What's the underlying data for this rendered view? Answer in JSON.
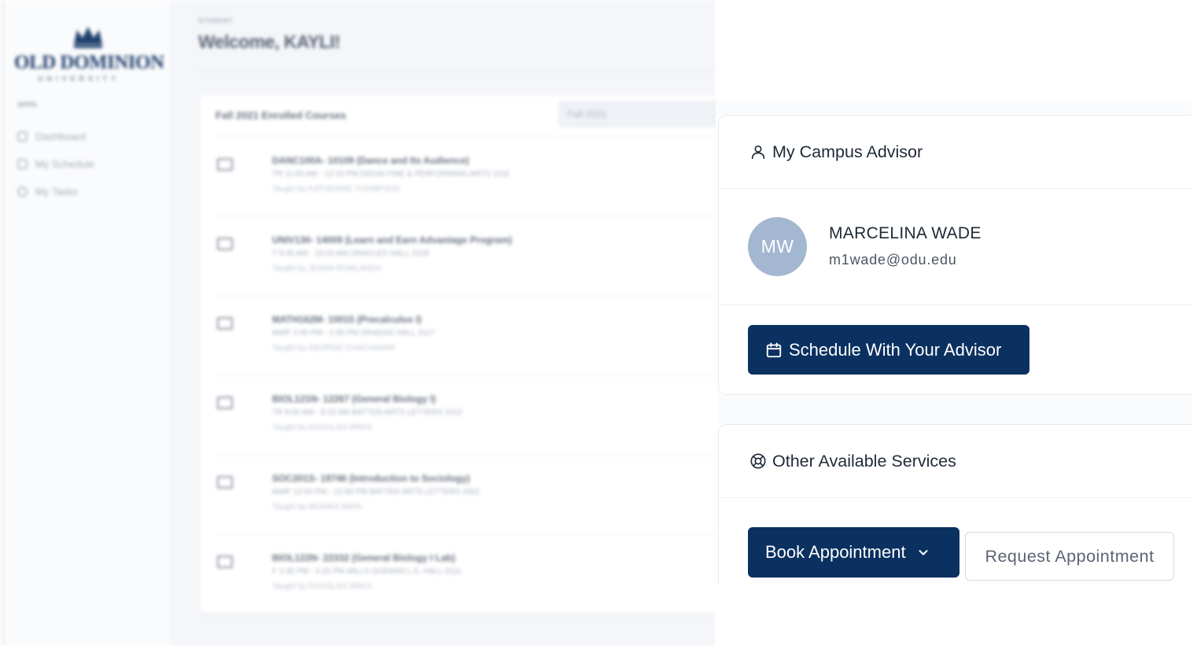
{
  "backdrop": {
    "logo": {
      "name": "OLD DOMINION",
      "sub": "UNIVERSITY"
    },
    "sidebar_caption": "APPS",
    "sidebar_items": [
      {
        "label": "Dashboard",
        "icon": "grid-icon"
      },
      {
        "label": "My Schedule",
        "icon": "calendar-icon"
      },
      {
        "label": "My Tasks",
        "icon": "clock-icon"
      }
    ],
    "breadcrumb": "STUDENT",
    "welcome": "Welcome, KAYLI!",
    "courses_title": "Fall 2021 Enrolled Courses",
    "term_select": "Fall 2021",
    "courses": [
      {
        "name": "DANC100A- 10109 (Dance and Its Audience)",
        "meta": "TR 11:00 AM - 12:15 PM DIEHN FINE & PERFORMING ARTS 1102",
        "taught_by": "Taught by KATHERINE THOMPSON"
      },
      {
        "name": "UNIV130- 14009 (Learn and Earn Advantage Program)",
        "meta": "T 9:30 AM - 10:20 AM ORACLES HALL 3108",
        "taught_by": "Taught by JENNA ROWLANDS"
      },
      {
        "name": "MATH162M- 10015 (Precalculus I)",
        "meta": "MWF 2:00 PM - 2:50 PM DRAGAS HALL 2117",
        "taught_by": "Taught by GEORGE CHACHANAR"
      },
      {
        "name": "BIOL121N- 12267 (General Biology I)",
        "meta": "TR 8:00 AM - 9:15 AM BATTEN ARTS LETTERS 1012",
        "taught_by": "Taught by DOUGLAS MRKS"
      },
      {
        "name": "SOC201S- 19746 (Introduction to Sociology)",
        "meta": "MWF 12:00 PM - 12:50 PM BATTEN ARTS LETTERS 2002",
        "taught_by": "Taught by MONIKA WIRA"
      },
      {
        "name": "BIOL122N- 22332 (General Biology I Lab)",
        "meta": "F 1:30 PM - 4:20 PM MILLS GODWIN L.S. HALL 0111",
        "taught_by": "Taught by DOUGLAS MRKS"
      }
    ]
  },
  "advisor_card": {
    "title": "My Campus Advisor",
    "icon": "user-icon",
    "avatar_initials": "MW",
    "advisor_name": "MARCELINA WADE",
    "advisor_email": "m1wade@odu.edu",
    "schedule_button": "Schedule With Your Advisor",
    "schedule_icon": "calendar-icon"
  },
  "services_card": {
    "title": "Other Available Services",
    "icon": "lifebuoy-icon",
    "book_button": "Book Appointment",
    "book_icon": "chevron-down-icon",
    "request_button": "Request Appointment"
  },
  "colors": {
    "primary": "#0b3160",
    "avatar": "#a4b7d0",
    "border": "#e7eaee"
  }
}
